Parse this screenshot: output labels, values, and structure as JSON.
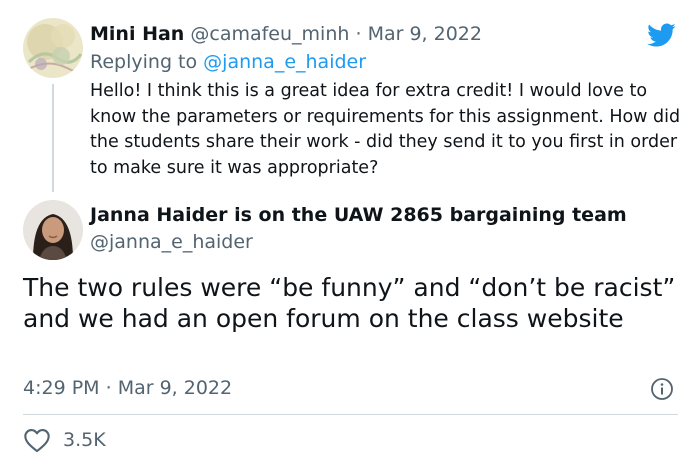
{
  "reply": {
    "author_name": "Mini Han",
    "author_handle": "@camafeu_minh",
    "separator": "·",
    "date": "Mar 9, 2022",
    "replying_prefix": "Replying to",
    "replying_to": "@janna_e_haider",
    "text": "Hello! I think this is a great idea for extra credit! I would love to know the parameters or requirements for this assignment. How did the students share their work - did they send it to you first in order to make sure it was appropriate?"
  },
  "main": {
    "author_name": "Janna Haider is on the UAW 2865 bargaining team",
    "author_handle": "@janna_e_haider",
    "text": "The two rules were “be funny” and “don’t be racist” and we had an open forum on the class website",
    "time": "4:29 PM",
    "separator": "·",
    "date": "Mar 9, 2022",
    "like_count": "3.5K"
  },
  "icons": {
    "platform": "twitter-bird-icon",
    "info": "info-icon",
    "like": "heart-icon"
  },
  "colors": {
    "accent": "#1d9bf0",
    "text": "#0f1419",
    "muted": "#536471",
    "divider": "#cfd9de"
  }
}
